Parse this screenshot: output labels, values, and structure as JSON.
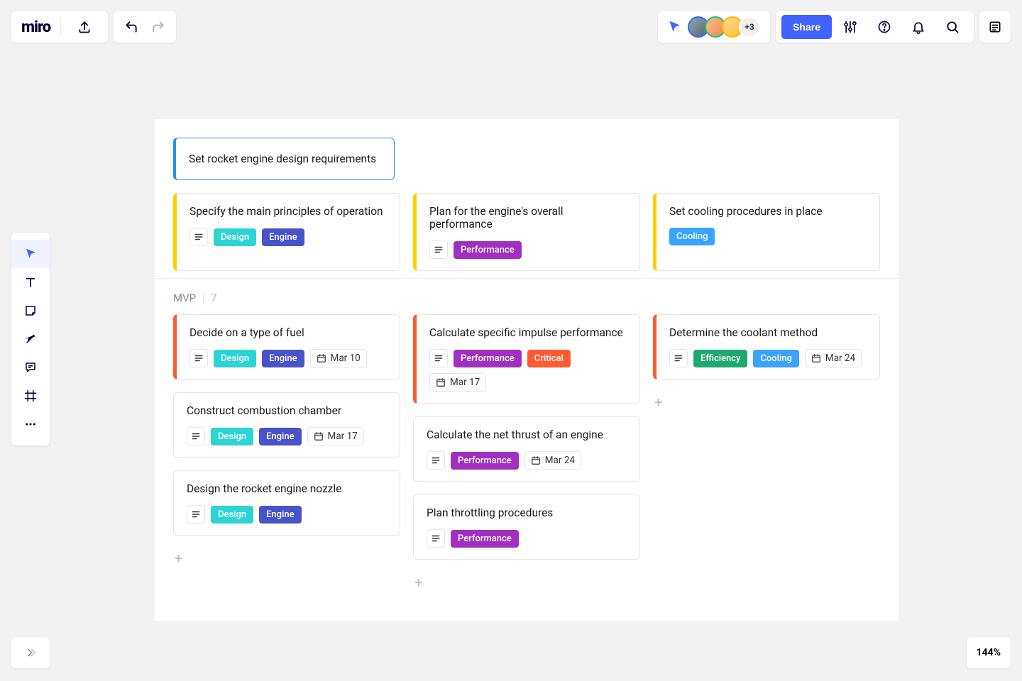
{
  "app": {
    "logo": "miro"
  },
  "toolbar": {
    "share_label": "Share",
    "more_avatars": "+3"
  },
  "zoom": "144%",
  "tags": {
    "design": {
      "label": "Design",
      "color": "#2dd4d4"
    },
    "engine": {
      "label": "Engine",
      "color": "#4a52c9"
    },
    "performance": {
      "label": "Performance",
      "color": "#a12fc0"
    },
    "cooling": {
      "label": "Cooling",
      "color": "#3aa3ff"
    },
    "critical": {
      "label": "Critical",
      "color": "#ff5b2e"
    },
    "efficiency": {
      "label": "Efficiency",
      "color": "#1fa971"
    }
  },
  "board": {
    "header_card": {
      "title": "Set rocket engine design requirements"
    },
    "top_row": [
      {
        "title": "Specify the main principles of operation",
        "tags": [
          "design",
          "engine"
        ],
        "has_desc": true
      },
      {
        "title": "Plan for the engine's overall performance",
        "tags": [
          "performance"
        ],
        "has_desc": true
      },
      {
        "title": "Set cooling procedures in place",
        "tags": [
          "cooling"
        ],
        "has_desc": false
      }
    ],
    "section2": {
      "name": "MVP",
      "count": "7",
      "columns": [
        [
          {
            "title": "Decide on a type of fuel",
            "bar": "orange",
            "tags": [
              "design",
              "engine"
            ],
            "date": "Mar 10",
            "has_desc": true
          },
          {
            "title": "Construct combustion chamber",
            "bar": "none",
            "tags": [
              "design",
              "engine"
            ],
            "date": "Mar 17",
            "has_desc": true
          },
          {
            "title": "Design the rocket engine nozzle",
            "bar": "none",
            "tags": [
              "design",
              "engine"
            ],
            "has_desc": true
          }
        ],
        [
          {
            "title": "Calculate specific impulse performance",
            "bar": "orange",
            "tags": [
              "performance",
              "critical"
            ],
            "date": "Mar 17",
            "has_desc": true
          },
          {
            "title": "Calculate the net thrust of an engine",
            "bar": "none",
            "tags": [
              "performance"
            ],
            "date": "Mar 24",
            "has_desc": true
          },
          {
            "title": "Plan throttling procedures",
            "bar": "none",
            "tags": [
              "performance"
            ],
            "has_desc": true
          }
        ],
        [
          {
            "title": "Determine the coolant method",
            "bar": "orange",
            "tags": [
              "efficiency",
              "cooling"
            ],
            "date": "Mar 24",
            "has_desc": true
          }
        ]
      ]
    }
  }
}
